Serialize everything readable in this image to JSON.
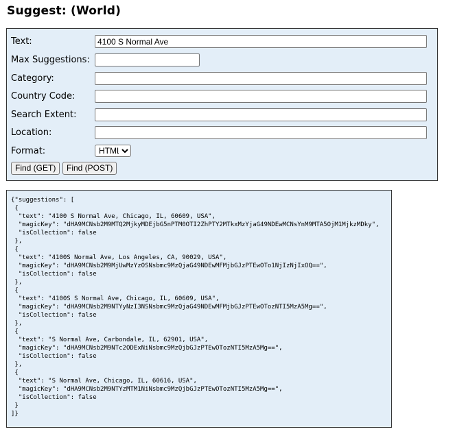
{
  "page": {
    "title": "Suggest: (World)"
  },
  "form": {
    "fields": {
      "text": {
        "label": "Text:",
        "value": "4100 S Normal Ave"
      },
      "max_suggestions": {
        "label": "Max Suggestions:",
        "value": ""
      },
      "category": {
        "label": "Category:",
        "value": ""
      },
      "country_code": {
        "label": "Country Code:",
        "value": ""
      },
      "search_extent": {
        "label": "Search Extent:",
        "value": ""
      },
      "location": {
        "label": "Location:",
        "value": ""
      },
      "format": {
        "label": "Format:",
        "value": "HTML"
      }
    },
    "buttons": {
      "find_get": "Find (GET)",
      "find_post": "Find (POST)"
    }
  },
  "output": {
    "text": "{\"suggestions\": [\n {\n  \"text\": \"4100 S Normal Ave, Chicago, IL, 60609, USA\",\n  \"magicKey\": \"dHA9MCNsb2M9MTQ2MjkyMDEjbG5nPTM0OTI2ZhPTY2MTkxMzYjaG49NDEwMCNsYnM9MTA5OjM1MjkzMDky\",\n  \"isCollection\": false\n },\n {\n  \"text\": \"4100S Normal Ave, Los Angeles, CA, 90029, USA\",\n  \"magicKey\": \"dHA9MCNsb2M9MjUwMzYzOSNsbmc9MzQjaG49NDEwMFMjbGJzPTEwOTo1NjIzNjIxOQ==\",\n  \"isCollection\": false\n },\n {\n  \"text\": \"4100S S Normal Ave, Chicago, IL, 60609, USA\",\n  \"magicKey\": \"dHA9MCNsb2M9NTYyNzI3NSNsbmc9MzQjaG49NDEwMFMjbGJzPTEwOTozNTI5MzA5Mg==\",\n  \"isCollection\": false\n },\n {\n  \"text\": \"S Normal Ave, Carbondale, IL, 62901, USA\",\n  \"magicKey\": \"dHA9MCNsb2M9NTc2ODExNiNsbmc9MzQjbGJzPTEwOTozNTI5MzA5Mg==\",\n  \"isCollection\": false\n },\n {\n  \"text\": \"S Normal Ave, Chicago, IL, 60616, USA\",\n  \"magicKey\": \"dHA9MCNsb2M9NTYzMTM1NiNsbmc9MzQjbGJzPTEwOTozNTI5MzA5Mg==\",\n  \"isCollection\": false\n }\n]}"
  }
}
